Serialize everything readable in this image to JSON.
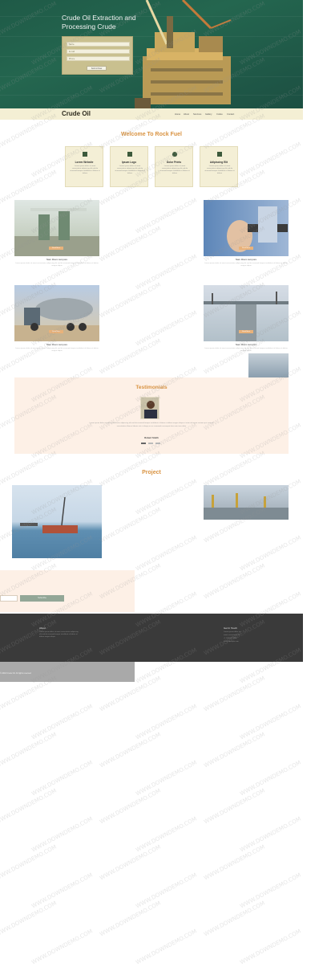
{
  "hero": {
    "title": "Crude Oil Extraction and Processing Crude",
    "form": {
      "name_placeholder": "Name",
      "email_placeholder": "E-mail",
      "phone_placeholder": "Phone",
      "submit_label": "Submit Now"
    }
  },
  "nav": {
    "brand": "Crude Oil",
    "links": [
      "Home",
      "About",
      "Services",
      "Gallery",
      "Codes",
      "Contact"
    ]
  },
  "welcome": {
    "title": "Welcome To Rock Fuel",
    "features": [
      {
        "icon": "factory-icon",
        "title": "Lorem Website",
        "desc": "Lorem ipsum dolor sit amet consectetur adipiscing elit sed do eiusmod tempor incididunt ut labore et dolore"
      },
      {
        "icon": "bar-chart-icon",
        "title": "Ipsum Logo",
        "desc": "Lorem ipsum dolor sit amet consectetur adipiscing elit sed do eiusmod tempor incididunt ut labore et dolore"
      },
      {
        "icon": "flame-icon",
        "title": "Dolor Prints",
        "desc": "Lorem ipsum dolor sit amet consectetur adipiscing elit sed do eiusmod tempor incididunt ut labore et dolore"
      },
      {
        "icon": "square-icon",
        "title": "Adipiscing Elit",
        "desc": "Lorem ipsum dolor sit amet consectetur adipiscing elit sed do eiusmod tempor incididunt ut labore et dolore"
      }
    ]
  },
  "services": [
    {
      "title": "Nam libero tempore",
      "desc": "Lorem ipsum dolor sit amet consectetur adipiscing elit sed do eiusmod tempor incididunt ut labore et dolore magna aliqua",
      "button": "Read More"
    },
    {
      "title": "Nam libero tempore",
      "desc": "Lorem ipsum dolor sit amet consectetur adipiscing elit sed do eiusmod tempor incididunt ut labore et dolore magna aliqua",
      "button": "Read More"
    },
    {
      "title": "Nam libero tempore",
      "desc": "Lorem ipsum dolor sit amet consectetur adipiscing elit sed do eiusmod tempor incididunt ut labore et dolore magna aliqua",
      "button": "Read More"
    },
    {
      "title": "Nam libero tempore",
      "desc": "Lorem ipsum dolor sit amet consectetur adipiscing elit sed do eiusmod tempor incididunt ut labore et dolore magna aliqua",
      "button": "Read More"
    }
  ],
  "testimonials": {
    "title": "Testimonials",
    "text": "Lorem ipsum dolor sit amet consectetur adipiscing elit sed do eiusmod tempor incididunt ut labore et dolore magna aliqua ut enim ad minim veniam quis nostrud exercitation ullamco laboris nisi ut aliquip ex ea commodo consequat duis aute irure dolor",
    "name": "Robert Smith"
  },
  "project": {
    "title": "Project"
  },
  "newsletter": {
    "button": "Subscribe"
  },
  "footer": {
    "about_title": "About",
    "about_text": "Lorem ipsum dolor sit amet consectetur adipiscing elit sed do eiusmod tempor incididunt ut labore et dolore magna aliqua",
    "contact_title": "Get In Touch",
    "contact_lines": [
      "Lorem ipsum dolor sit",
      "amet consectetur elit",
      "+1 234 567 8900",
      "info@example.com"
    ],
    "copyright": "© 2018 Crude Oil. All rights reserved"
  },
  "watermark": "WWW.DOWNDEMO.COM",
  "colors": {
    "accent": "#d99342",
    "nav_bg": "#f4efd4",
    "footer_bg": "#3a3a3a"
  }
}
